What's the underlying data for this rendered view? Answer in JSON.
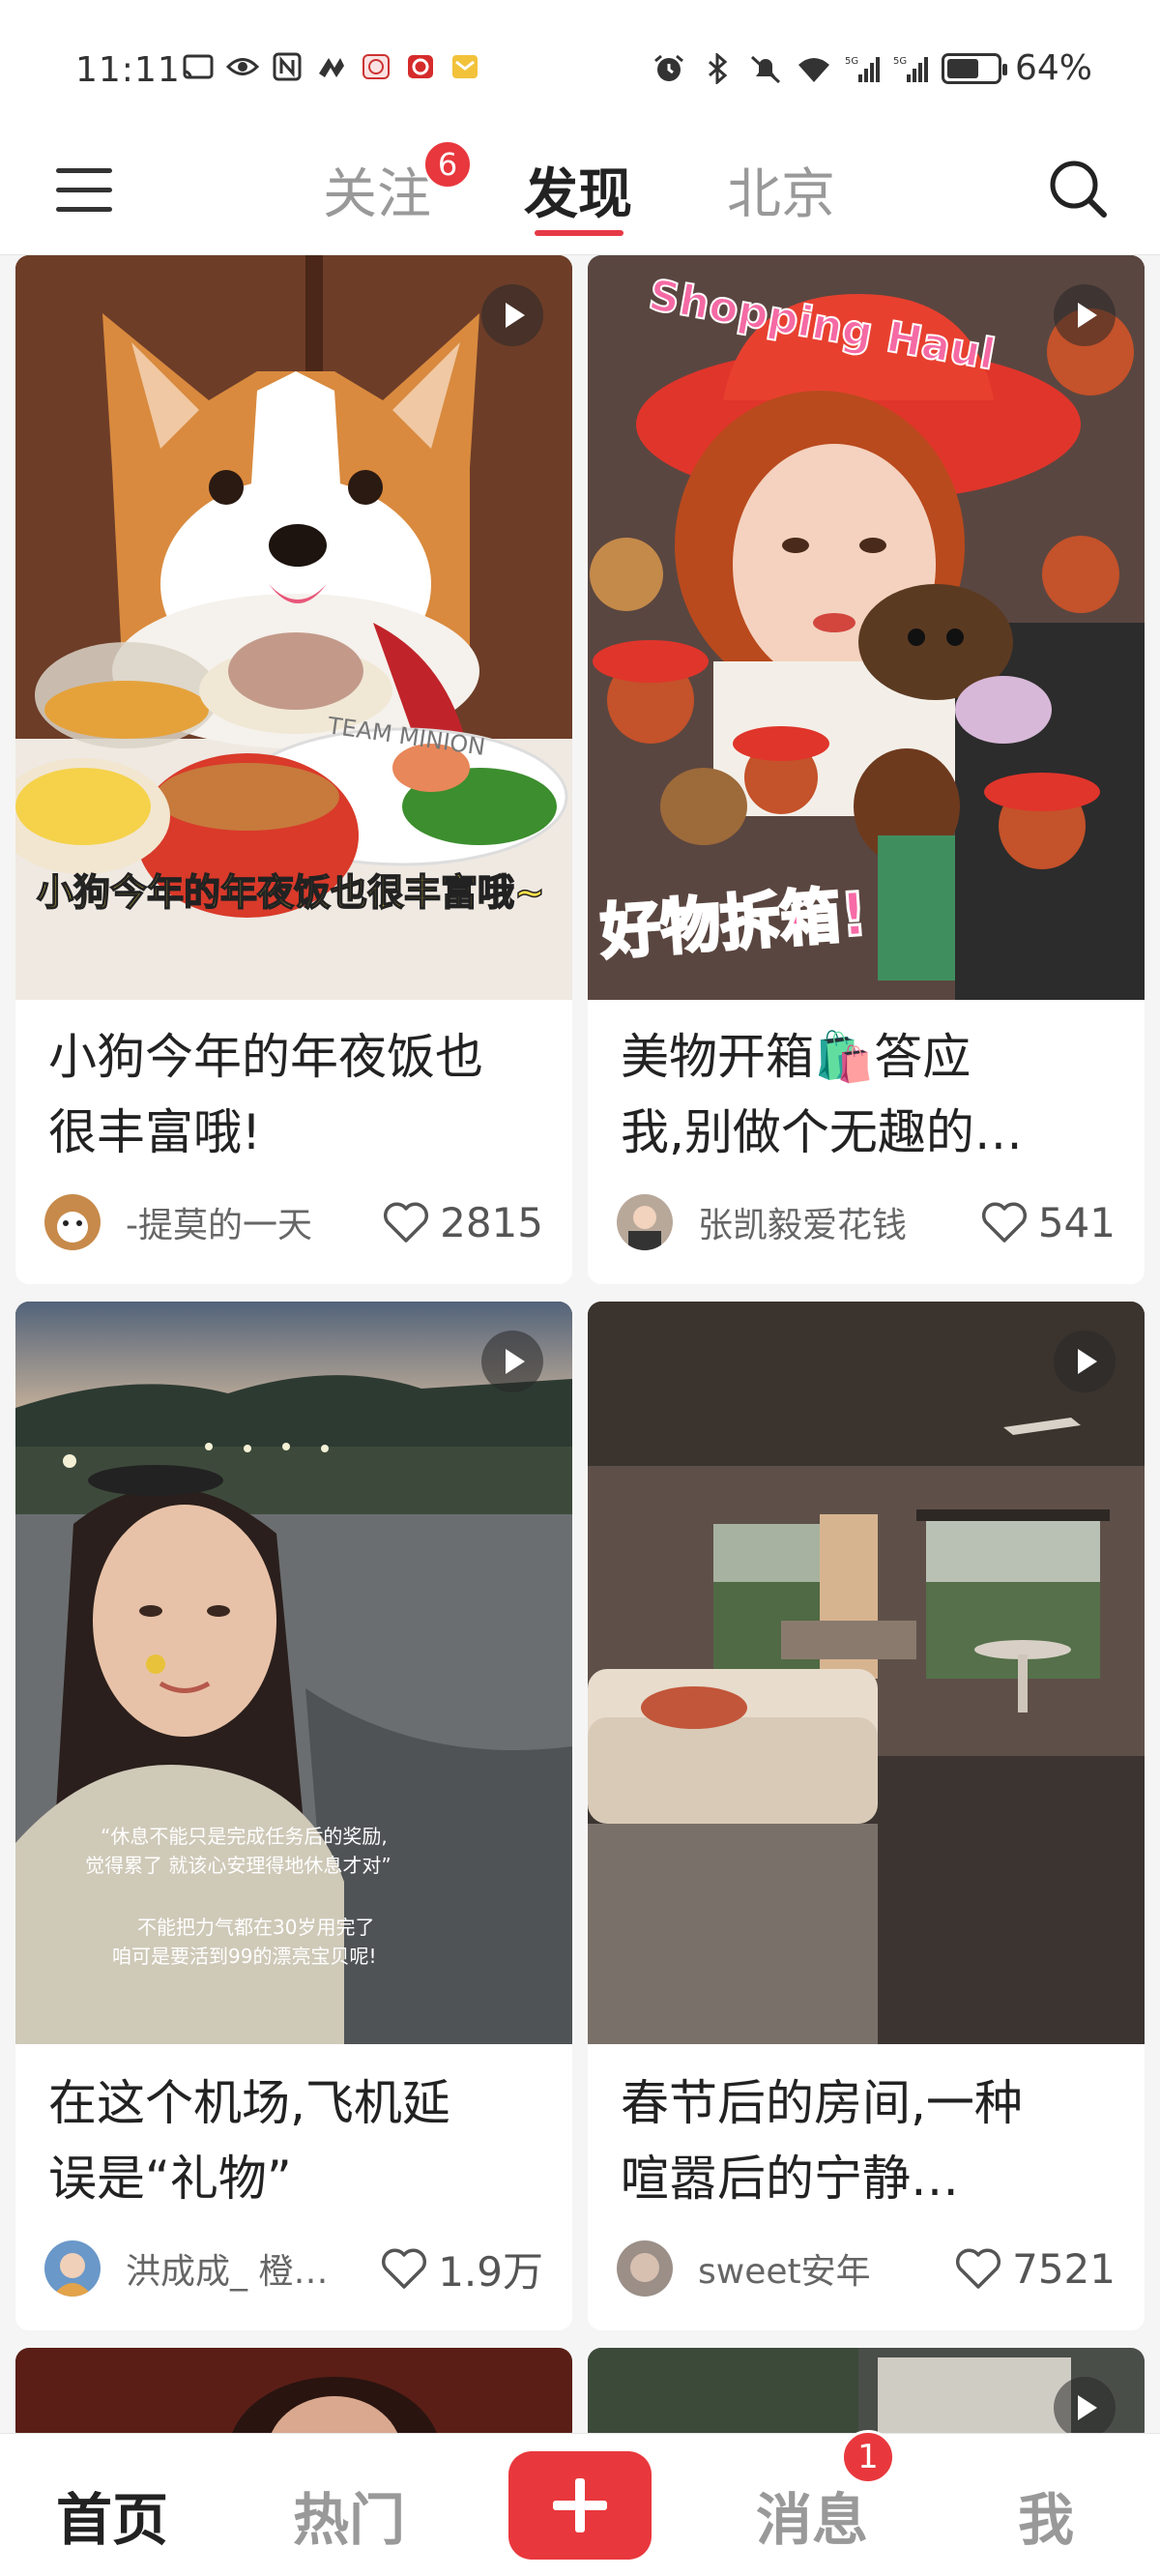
{
  "status_bar": {
    "time": "11:11",
    "battery_text": "64%",
    "battery_level": 0.64,
    "left_icons": [
      "screencast-icon",
      "eye-icon",
      "nfc-icon",
      "app-icon",
      "bank-icon",
      "unionpay-icon",
      "mail-icon"
    ],
    "right_icons": [
      "alarm-icon",
      "bluetooth-icon",
      "mute-icon",
      "wifi-icon",
      "signal-5g-icon",
      "signal-5g-icon"
    ]
  },
  "header": {
    "tabs": [
      {
        "label": "关注",
        "badge": "6"
      },
      {
        "label": "发现",
        "active": true
      },
      {
        "label": "北京"
      }
    ],
    "accent_color": "#e8383d"
  },
  "feed": [
    {
      "title_line1": "小狗今年的年夜饭也",
      "title_line2": "很丰富哦!",
      "overlay": "小狗今年的年夜饭也很丰富哦~",
      "plate_text": "TEAM MINION",
      "author": "-提莫的一天",
      "likes": "2815",
      "is_video": true
    },
    {
      "title_line1": "美物开箱🛍️答应",
      "title_line2": "我,别做个无趣的…",
      "overlay_top": "Shopping Haul",
      "overlay": "好物拆箱!",
      "author": "张凯毅爱花钱",
      "likes": "541",
      "is_video": true
    },
    {
      "title_line1": "在这个机场,飞机延",
      "title_line2": "误是“礼物”",
      "overlay_line1": "“休息不能只是完成任务后的奖励,",
      "overlay_line2": "觉得累了 就该心安理得地休息才对”",
      "overlay_line3": "不能把力气都在30岁用完了",
      "overlay_line4": "咱可是要活到99的漂亮宝贝呢!",
      "author": "洪成成_ 橙…",
      "likes": "1.9万",
      "is_video": true
    },
    {
      "title_line1": "春节后的房间,一种",
      "title_line2": "喧嚣后的宁静…",
      "author": "sweet安年",
      "likes": "7521",
      "is_video": true
    }
  ],
  "bottom_nav": {
    "home": "首页",
    "hot": "热门",
    "messages": "消息",
    "messages_badge": "1",
    "me": "我"
  }
}
